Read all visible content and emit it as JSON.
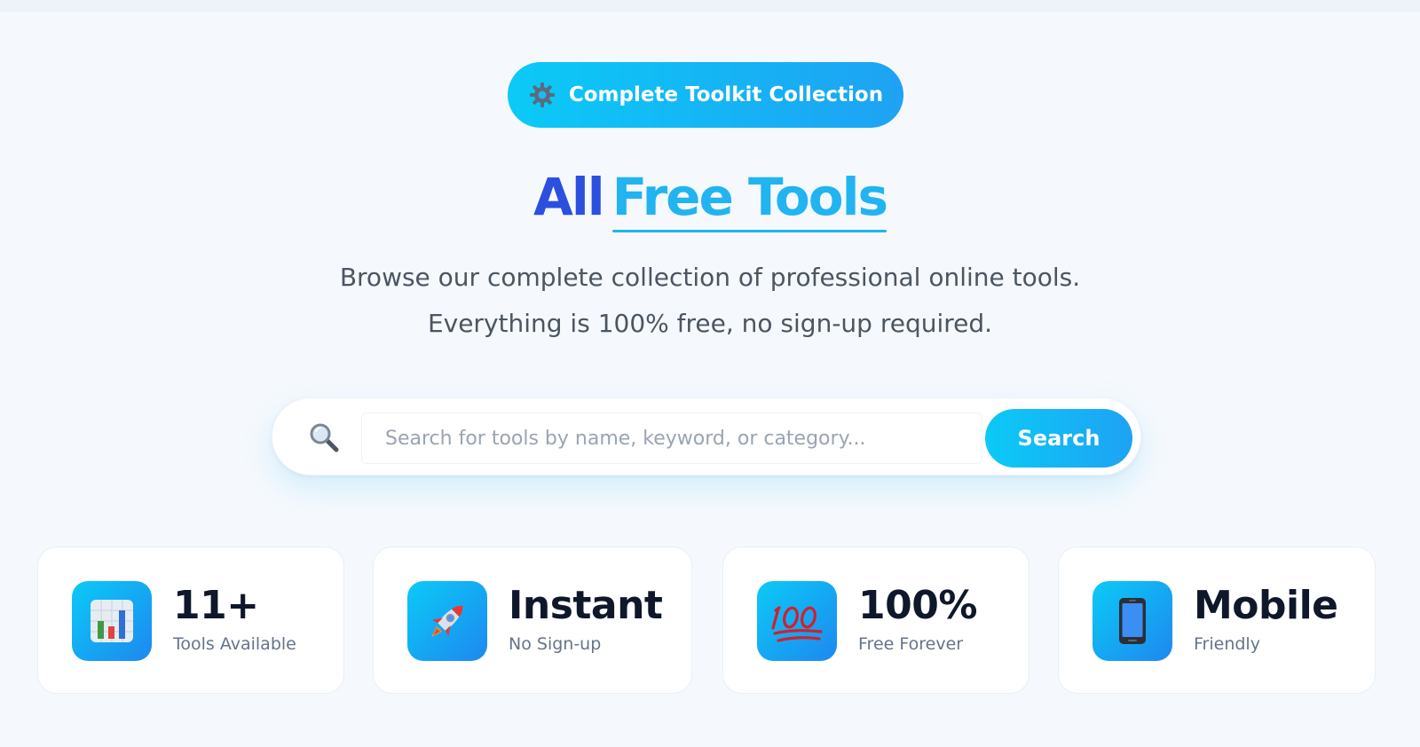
{
  "badge": {
    "icon": "gear-icon",
    "label": "Complete Toolkit Collection"
  },
  "title": {
    "part1": "All",
    "part2": "Free Tools"
  },
  "subtitle": {
    "line1": "Browse our complete collection of professional online tools.",
    "line2": "Everything is 100% free, no sign-up required."
  },
  "search": {
    "icon": "search-icon",
    "placeholder": "Search for tools by name, keyword, or category...",
    "value": "",
    "button_label": "Search"
  },
  "stats": [
    {
      "icon": "bar-chart-icon",
      "value": "11+",
      "label": "Tools Available"
    },
    {
      "icon": "rocket-icon",
      "value": "Instant",
      "label": "No Sign-up"
    },
    {
      "icon": "hundred-icon",
      "value": "100%",
      "label": "Free Forever"
    },
    {
      "icon": "mobile-phone-icon",
      "value": "Mobile",
      "label": "Friendly"
    }
  ],
  "colors": {
    "accent_start": "#0bcaf6",
    "accent_end": "#1ea2f3",
    "title_primary": "#2c4fe0",
    "title_secondary": "#22b4f0",
    "background": "#f5f9fd"
  }
}
